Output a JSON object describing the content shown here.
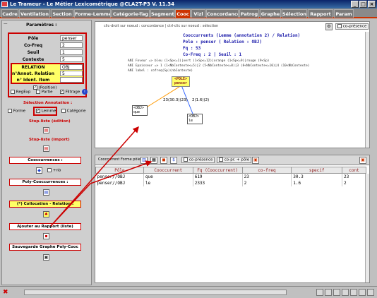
{
  "window": {
    "title": "Le Trameur - Le Métier Lexicométrique @CLA2T-P3 V. 11.34",
    "minimize": "_",
    "maximize": "□",
    "close": "×"
  },
  "tabs": [
    {
      "label": "Cadre"
    },
    {
      "label": "Ventilation"
    },
    {
      "label": "Section"
    },
    {
      "label": "Forme-Lemme"
    },
    {
      "label": "Catégorie-Tag"
    },
    {
      "label": "Segment"
    },
    {
      "label": "Cooc"
    },
    {
      "label": "Vizl"
    },
    {
      "label": "Concordance"
    },
    {
      "label": "Patrog"
    },
    {
      "label": "Graphe"
    },
    {
      "label": "Sélection"
    },
    {
      "label": "Rapport"
    },
    {
      "label": "Param"
    }
  ],
  "left": {
    "params_title": "Paramètres :",
    "pole_label": "Pôle",
    "pole_value": "penser",
    "cofreq_label": "Co-Freq",
    "cofreq_value": "2",
    "seuil_label": "Seuil",
    "seuil_value": "1",
    "contexte_label": "Contexte",
    "contexte_value": "5",
    "relation_label": "RELATION",
    "relation_value": "OBJ",
    "annot_label": "n°Annot. Relation",
    "annot_value": "5",
    "ident_label": "n° Ident. Item",
    "ident_value": "",
    "position_label": "(Position)",
    "regexp_label": "RegExp",
    "partie_label": "Partie",
    "filtrage_label": "Filtrage",
    "selection_label": "Sélection Annotation :",
    "forme_label": "Forme",
    "lemme_label": "Lemme",
    "categorie_label": "Catégorie",
    "stop_edition": "Stop-liste (édition)",
    "stop_import": "Stop-liste (import)",
    "cooccurrences": "Cooccurrences :",
    "nb_label": "+nb",
    "poly_cooc": "Poly-Cooccurrences :",
    "collocation": "(*) Collocation - Relation :",
    "ajouter_rapport": "Ajouter au Rapport (liste)",
    "sauvegarde_graphe": "Sauvegarde Graphe Poly-Cooc"
  },
  "graph": {
    "hint": "clic-droit sur noeud : concordance | ctrl-clic sur noeud : sélection",
    "ecorr_label": "co-présence",
    "header_line1": "Cooccurrents (Lemme (annotation 2) / Relation)",
    "header_line2": "Pole : penser ( Relation : OBJ)",
    "header_line3": "Fq : 53",
    "header_line4": "Co-Freq : 2 | Seuil : 1",
    "info1": "ANI Foveur => bleu (1<Sp<=1)|vert (1<Sp<=12)|orange (1<Sp<=9)|rouge (9<Sp)",
    "info2": "ANI Epaisseur => 1 (1<NbContexte<=5)|2 (5<NbContexte<=8)|3 (8<NbContexte<=10)|4 (10<NbContexte)",
    "info3": "ANI label : cofreq(Sp)(nbContexte)",
    "pole_node_l1": "<POLE>",
    "pole_node_l2": "penser",
    "node1_l1": "<OBJ>",
    "node1_l2": "que",
    "node2_l1": "<OBJ>",
    "node2_l2": "le",
    "edge1_label": "23(30.3)(23)",
    "edge2_label": "2(1.6)(2)"
  },
  "table": {
    "toolbar_label": "Cooccurrent Forme pôle",
    "check1": "co-présence",
    "check2": "co-pr. + pôle",
    "columns": [
      "Pôle",
      "Cooccurrent",
      "Fq (Cooccurrent)",
      "co-freq",
      "specif",
      "cont"
    ],
    "rows": [
      [
        "penser//OBJ",
        "que",
        "619",
        "23",
        "30.3",
        "23"
      ],
      [
        "penser//OBJ",
        "le",
        "2333",
        "2",
        "1.6",
        "2"
      ]
    ]
  },
  "colors": {
    "accent": "#cc3300",
    "highlight": "#cc0000",
    "node_yellow": "#ffff66"
  }
}
